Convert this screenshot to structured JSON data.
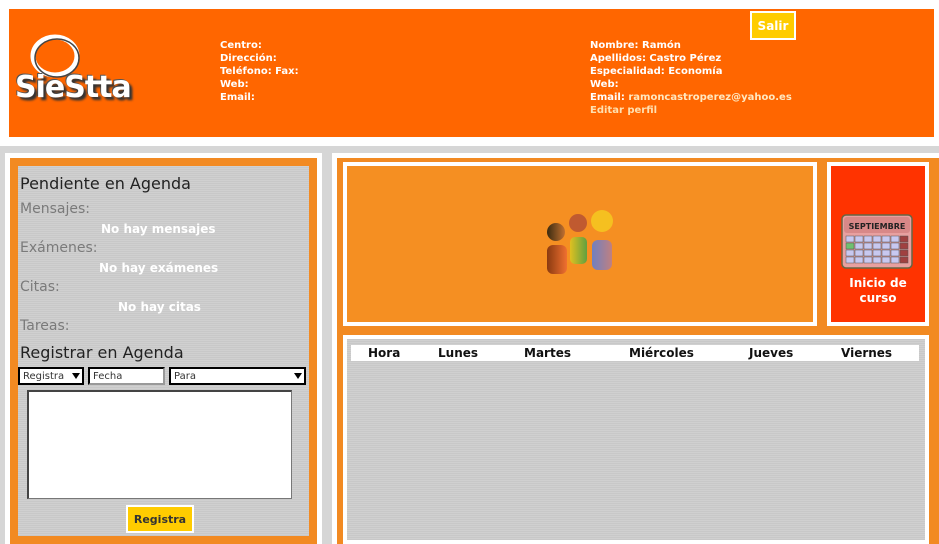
{
  "header": {
    "logo_text": "SieStta",
    "logout_label": "Salir",
    "center": {
      "centro": "Centro:",
      "direccion": "Dirección:",
      "telefono": "Teléfono: Fax:",
      "web": "Web:",
      "email": "Email:"
    },
    "user": {
      "nombre": "Nombre: Ramón",
      "apellidos": "Apellidos: Castro Pérez",
      "especialidad": "Especialidad: Economía",
      "web": "Web:",
      "email_label": "Email:",
      "email_value": "ramoncastroperez@yahoo.es",
      "edit_profile": "Editar perfil"
    }
  },
  "agenda": {
    "pending_title": "Pendiente en Agenda",
    "messages_label": "Mensajes:",
    "messages_empty": "No hay mensajes",
    "exams_label": "Exámenes:",
    "exams_empty": "No hay exámenes",
    "appointments_label": "Citas:",
    "appointments_empty": "No hay citas",
    "tasks_label": "Tareas:",
    "register_title": "Registrar en Agenda",
    "type_select": "Registra",
    "date_placeholder": "Fecha",
    "to_select": "Para",
    "submit_label": "Registra"
  },
  "calendar": {
    "month": "SEPTIEMBRE",
    "caption_line1": "Inicio de",
    "caption_line2": "curso"
  },
  "schedule": {
    "columns": [
      "Hora",
      "Lunes",
      "Martes",
      "Miércoles",
      "Jueves",
      "Viernes"
    ]
  },
  "colors": {
    "header_orange": "#ff6600",
    "panel_orange": "#f28a22",
    "button_yellow": "#ffcc00",
    "calendar_red": "#ff3300"
  }
}
